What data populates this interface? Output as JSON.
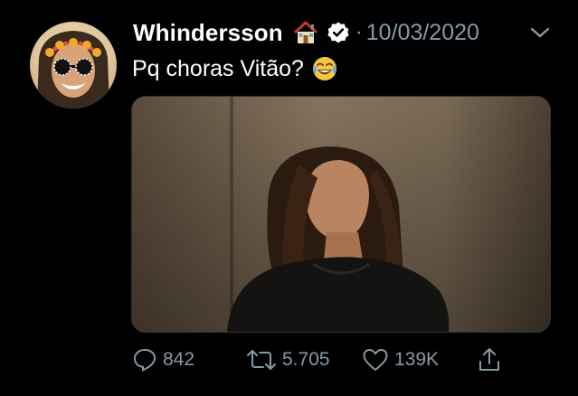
{
  "tweet": {
    "author_name": "Whindersson",
    "separator": "·",
    "date": "10/03/2020",
    "text": "Pq choras Vitão?",
    "name_emoji": "house-icon",
    "text_emoji": "face-with-tears-of-joy-icon"
  },
  "actions": {
    "reply_count": "842",
    "retweet_count": "5.705",
    "like_count": "139K"
  },
  "colors": {
    "background": "#000000",
    "text_primary": "#ffffff",
    "text_secondary": "#8899a6",
    "border": "#2f3336"
  }
}
